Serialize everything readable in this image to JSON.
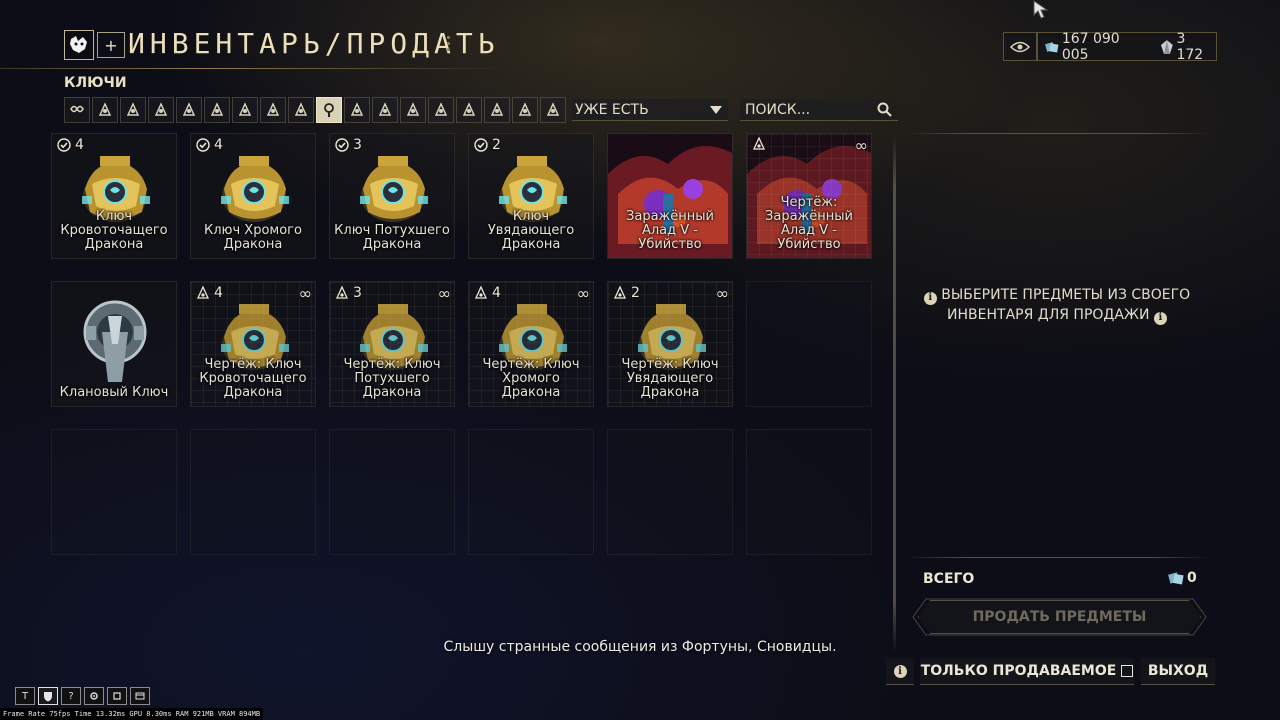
{
  "header": {
    "title": "ИНВЕНТАРЬ/ПРОДАТЬ",
    "add_label": "+"
  },
  "currency": {
    "credits": "167 090 005",
    "platinum": "3 172"
  },
  "section": {
    "label": "КЛЮЧИ"
  },
  "filters": [
    {
      "icon": "infinity-icon",
      "active": false
    },
    {
      "icon": "warframe-icon",
      "active": false
    },
    {
      "icon": "primary-weapon-icon",
      "active": false
    },
    {
      "icon": "secondary-weapon-icon",
      "active": false
    },
    {
      "icon": "melee-weapon-icon",
      "active": false
    },
    {
      "icon": "sentinel-icon",
      "active": false
    },
    {
      "icon": "companion-icon",
      "active": false
    },
    {
      "icon": "mods-icon",
      "active": false
    },
    {
      "icon": "relic-icon",
      "active": false
    },
    {
      "icon": "key-icon",
      "active": true
    },
    {
      "icon": "resource-icon",
      "active": false
    },
    {
      "icon": "fish-icon",
      "active": false
    },
    {
      "icon": "archwing-icon",
      "active": false
    },
    {
      "icon": "gear-item-icon",
      "active": false
    },
    {
      "icon": "kubrow-icon",
      "active": false
    },
    {
      "icon": "captura-icon",
      "active": false
    },
    {
      "icon": "decoration-icon",
      "active": false
    },
    {
      "icon": "arcane-icon",
      "active": false
    }
  ],
  "dropdown": {
    "value": "УЖЕ ЕСТЬ"
  },
  "search": {
    "placeholder": "ПОИСК..."
  },
  "items": [
    {
      "label": "Ключ Кровоточащего Дракона",
      "badge_type": "owned",
      "count": "4",
      "inf": "",
      "art": "key-gold",
      "blueprint": false
    },
    {
      "label": "Ключ Хромого Дракона",
      "badge_type": "owned",
      "count": "4",
      "inf": "",
      "art": "key-gold",
      "blueprint": false
    },
    {
      "label": "Ключ Потухшего Дракона",
      "badge_type": "owned",
      "count": "3",
      "inf": "",
      "art": "key-gold",
      "blueprint": false
    },
    {
      "label": "Ключ Увядающего Дракона",
      "badge_type": "owned",
      "count": "2",
      "inf": "",
      "art": "key-gold",
      "blueprint": false
    },
    {
      "label": "Заражённый Алад V - Убийство",
      "badge_type": "",
      "count": "",
      "inf": "",
      "art": "alad",
      "blueprint": false
    },
    {
      "label": "Чертёж: Заражённый Алад V - Убийство",
      "badge_type": "blueprint",
      "count": "",
      "inf": "∞",
      "art": "alad",
      "blueprint": true
    },
    {
      "label": "Клановый Ключ",
      "badge_type": "",
      "count": "",
      "inf": "",
      "art": "clan-key",
      "blueprint": false
    },
    {
      "label": "Чертёж: Ключ Кровоточащего Дракона",
      "badge_type": "blueprint",
      "count": "4",
      "inf": "∞",
      "art": "key-gold",
      "blueprint": true
    },
    {
      "label": "Чертёж: Ключ Потухшего Дракона",
      "badge_type": "blueprint",
      "count": "3",
      "inf": "∞",
      "art": "key-gold",
      "blueprint": true
    },
    {
      "label": "Чертёж: Ключ Хромого Дракона",
      "badge_type": "blueprint",
      "count": "4",
      "inf": "∞",
      "art": "key-gold",
      "blueprint": true
    },
    {
      "label": "Чертёж: Ключ Увядающего Дракона",
      "badge_type": "blueprint",
      "count": "2",
      "inf": "∞",
      "art": "key-gold",
      "blueprint": true
    }
  ],
  "panel": {
    "hint": "ВЫБЕРИТЕ ПРЕДМЕТЫ ИЗ СВОЕГО ИНВЕНТАРЯ ДЛЯ ПРОДАЖИ",
    "total_label": "ВСЕГО",
    "total_value": "0",
    "sell_button": "ПРОДАТЬ ПРЕДМЕТЫ",
    "only_sellable": "ТОЛЬКО ПРОДАВАЕМОЕ",
    "exit": "ВЫХОД"
  },
  "chat_message": "Слышу странные сообщения из Фортуны, Сновидцы.",
  "toolbar": {
    "t_label": "T",
    "help_label": "?"
  },
  "perf": {
    "text": "Frame Rate 75fps Time 13.32ms GPU 8.30ms RAM 921MB VRAM 894MB"
  }
}
